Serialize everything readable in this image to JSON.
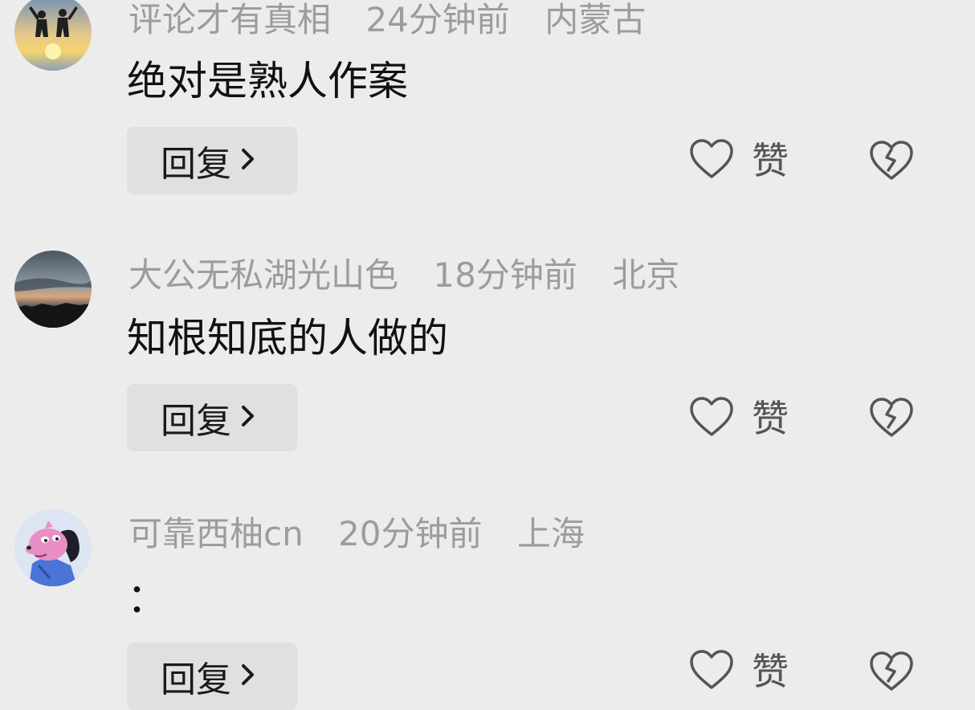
{
  "comments": [
    {
      "username": "评论才有真相",
      "time": "24分钟前",
      "location": "内蒙古",
      "text": "绝对是熟人作案",
      "reply_label": "回复",
      "like_label": "赞",
      "avatar_icon": "avatar-sunset-silhouette"
    },
    {
      "username": "大公无私湖光山色",
      "time": "18分钟前",
      "location": "北京",
      "text": "知根知底的人做的",
      "reply_label": "回复",
      "like_label": "赞",
      "avatar_icon": "avatar-dusk-sky"
    },
    {
      "username": "可靠西柚cn",
      "time": "20分钟前",
      "location": "上海",
      "text": "：",
      "reply_label": "回复",
      "like_label": "赞",
      "avatar_icon": "avatar-cartoon-dog"
    }
  ],
  "colors": {
    "background": "#ececec",
    "meta_text": "#9c9c9c",
    "body_text": "#111111",
    "reply_bg": "#e0e0e0",
    "icon_stroke": "#555555"
  }
}
